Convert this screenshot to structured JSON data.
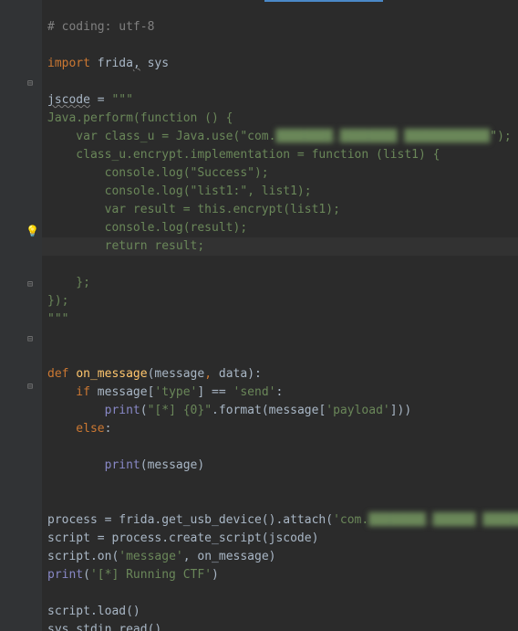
{
  "code": {
    "l1": "# coding: utf-8",
    "l3_import": "import",
    "l3_mods": " frida",
    "l3_comma": ",",
    "l3_sys": " sys",
    "l5_var": "jscode",
    "l5_eq": " = ",
    "l5_str": "\"\"\"",
    "l6": "Java.perform(function () {",
    "l7_a": "    var class_u = Java.use(\"com.",
    "l7_blur": "████████.████████ ████████████",
    "l7_b": "\");",
    "l8": "    class_u.encrypt.implementation = function (list1) {",
    "l9": "        console.log(\"Success\");",
    "l10": "        console.log(\"list1:\", list1);",
    "l11": "        var result = this.encrypt(list1);",
    "l12": "        console.log(result);",
    "l13": "        return result;",
    "l14": "    };",
    "l15": "});",
    "l16": "\"\"\"",
    "l19_def": "def ",
    "l19_fn": "on_message",
    "l19_p1": "(",
    "l19_msg": "message",
    "l19_c": ", ",
    "l19_data": "data",
    "l19_p2": "):",
    "l20_if": "    if ",
    "l20_a": "message[",
    "l20_s": "'type'",
    "l20_b": "] == ",
    "l20_s2": "'send'",
    "l20_c": ":",
    "l21_a": "        ",
    "l21_print": "print",
    "l21_b": "(",
    "l21_s": "\"[*] {0}\"",
    "l21_c": ".format(message[",
    "l21_s2": "'payload'",
    "l21_d": "]))",
    "l22_else": "    else",
    "l22_c": ":",
    "l24_a": "        ",
    "l24_print": "print",
    "l24_b": "(message)",
    "l27_a": "process = frida.get_usb_device().attach(",
    "l27_s": "'com.",
    "l27_blur": "████████.██████ ███████",
    "l27_s2": "'",
    "l27_b": ")",
    "l28_a": "script = process.create_script(jscode)",
    "l29_a": "script.on(",
    "l29_s": "'message'",
    "l29_b": ", on_message)",
    "l30_print": "print",
    "l30_a": "(",
    "l30_s": "'[*] Running CTF'",
    "l30_b": ")",
    "l32": "script.load()",
    "l33": "sys.stdin.read()"
  }
}
